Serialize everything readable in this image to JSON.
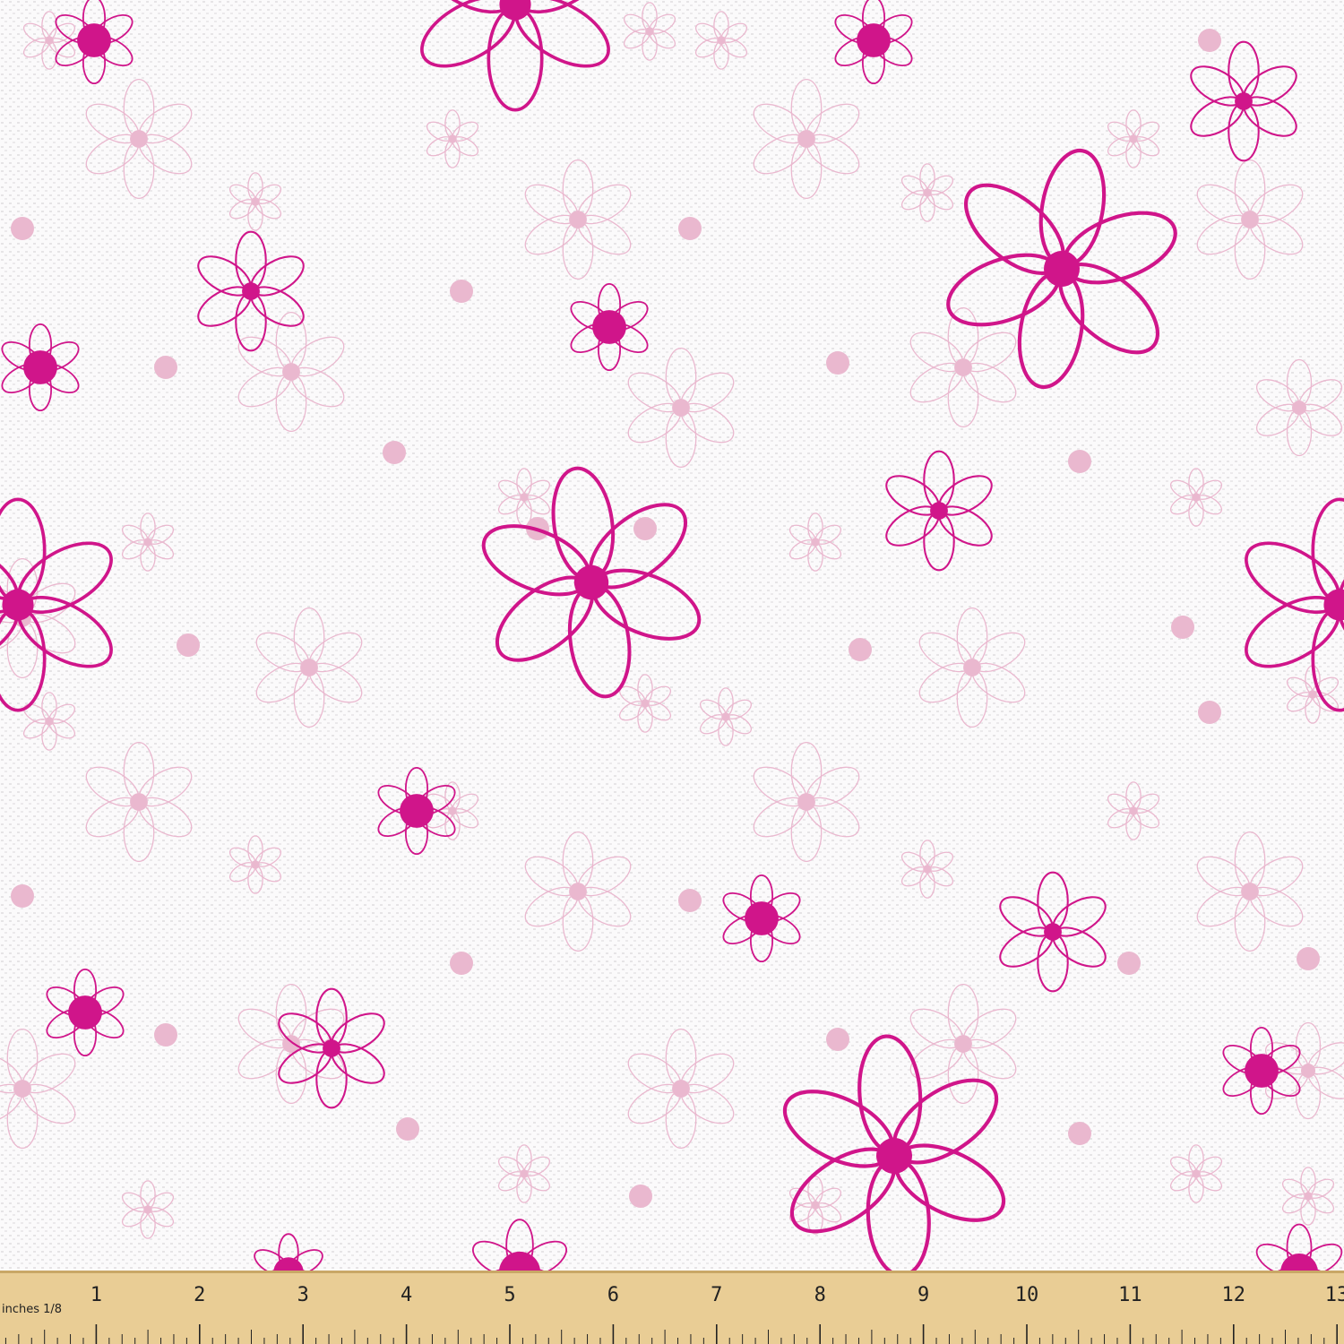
{
  "image": {
    "subject": "fabric-swatch",
    "pattern": "daisy-flowers",
    "colors": {
      "background": "#fbfafb",
      "weave": "#e6e4e6",
      "flower_bold": "#d0158a",
      "flower_faint": "#eab8cf",
      "ruler_wood": "#e9cd95",
      "ruler_edge": "#c9a766",
      "ruler_ink": "#222222"
    }
  },
  "ruler": {
    "unit_label": "inches 1/8",
    "numbers": [
      "1",
      "2",
      "3",
      "4",
      "5",
      "6",
      "7",
      "8",
      "9",
      "10",
      "11",
      "12",
      "13"
    ]
  }
}
